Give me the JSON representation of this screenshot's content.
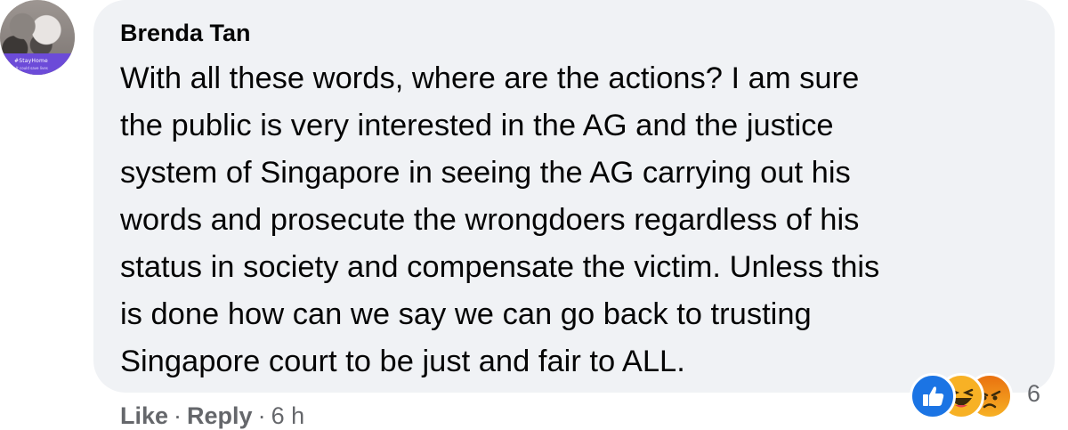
{
  "comment": {
    "author": "Brenda Tan",
    "body_lines": [
      "With all these words, where are the actions? I am sure",
      "the public is very interested in the AG and the justice",
      "system of Singapore in seeing the AG carrying out his",
      "words and prosecute the wrongdoers regardless of his",
      "status in society and compensate the victim. Unless this",
      "is done how can we say we can go back to trusting",
      "Singapore court to be just and fair to ALL."
    ],
    "avatar_frame_text": "#StayHome",
    "avatar_frame_subtext": "It could save lives",
    "reactions": {
      "icons": [
        "like-icon",
        "haha-icon",
        "angry-icon"
      ],
      "count": "6"
    },
    "actions": {
      "like_label": "Like",
      "reply_label": "Reply",
      "separator": "·",
      "timestamp": "6 h"
    }
  },
  "colors": {
    "bubble": "#f0f2f5",
    "text": "#050505",
    "secondary": "#65676b",
    "like_blue": "#1b74e4",
    "haha_yellow": "#f7b125",
    "avatar_frame": "#6c4bd8"
  }
}
